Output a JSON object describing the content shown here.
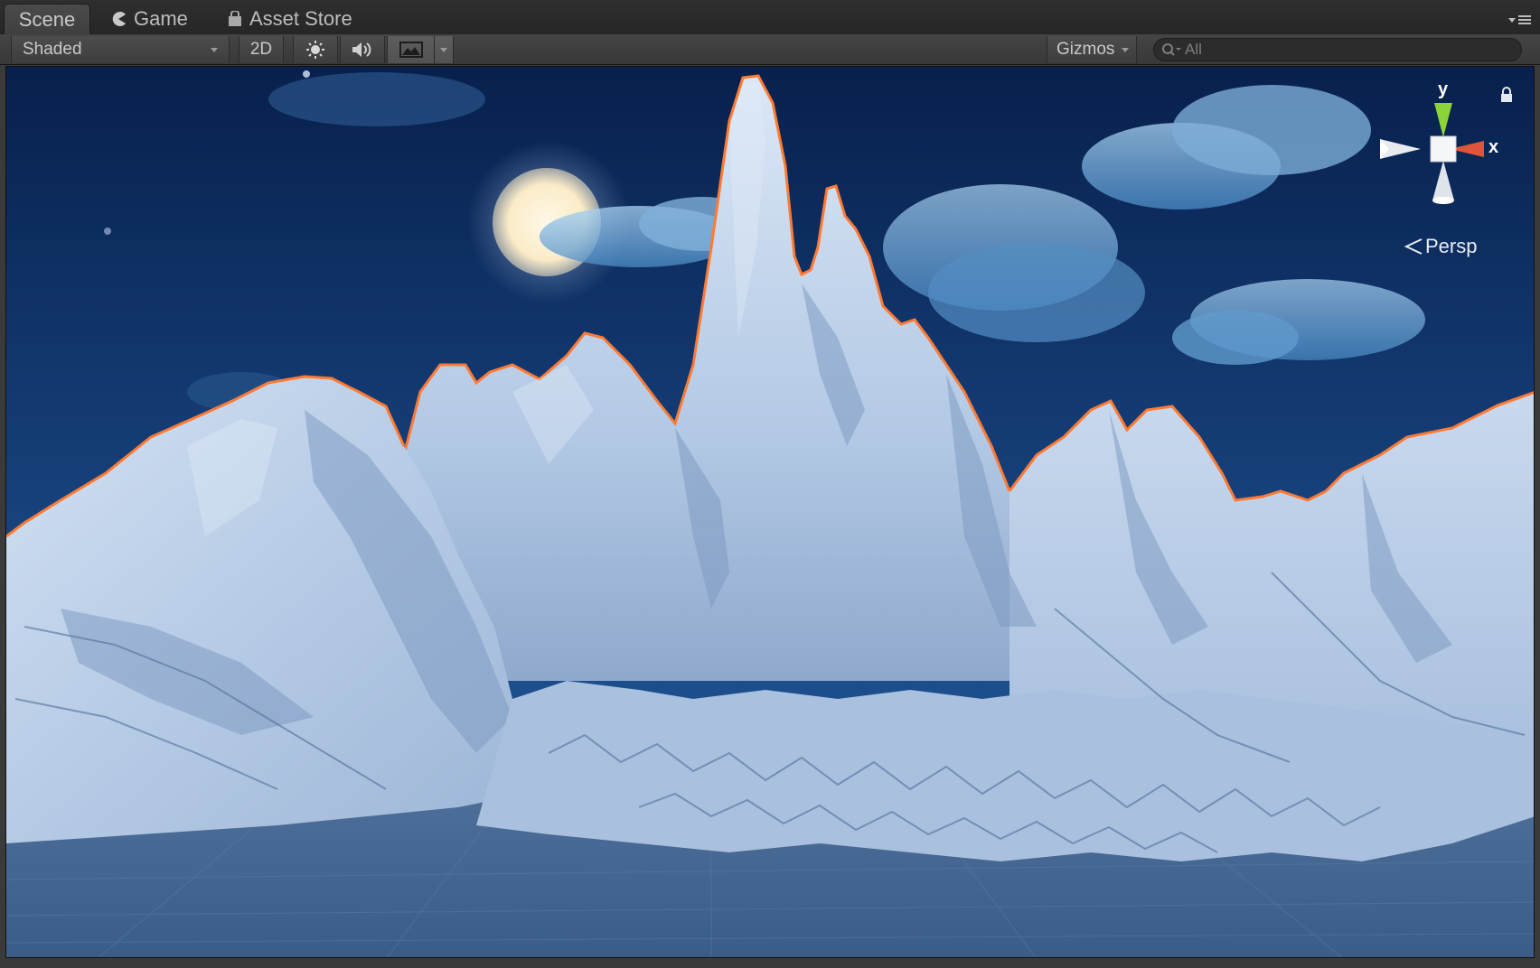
{
  "tabs": [
    {
      "label": "Scene",
      "active": true
    },
    {
      "label": "Game",
      "active": false
    },
    {
      "label": "Asset Store",
      "active": false
    }
  ],
  "toolbar": {
    "render_mode": "Shaded",
    "mode_2d": "2D",
    "lighting_icon": "sun-icon",
    "audio_icon": "speaker-icon",
    "effects_icon": "image-icon",
    "gizmos_label": "Gizmos",
    "search_placeholder": "All"
  },
  "gizmo": {
    "y_label": "y",
    "x_label": "x",
    "projection": "Persp"
  },
  "colors": {
    "sky_top": "#08204c",
    "sky_mid": "#1b4a86",
    "terrain": "#b8cce6",
    "terrain_shadow": "#5f7ea8",
    "selection_outline": "#ff7a33",
    "axis_y": "#8dd43a",
    "axis_x": "#e0553a",
    "ground_grid": "#3f5f88"
  }
}
